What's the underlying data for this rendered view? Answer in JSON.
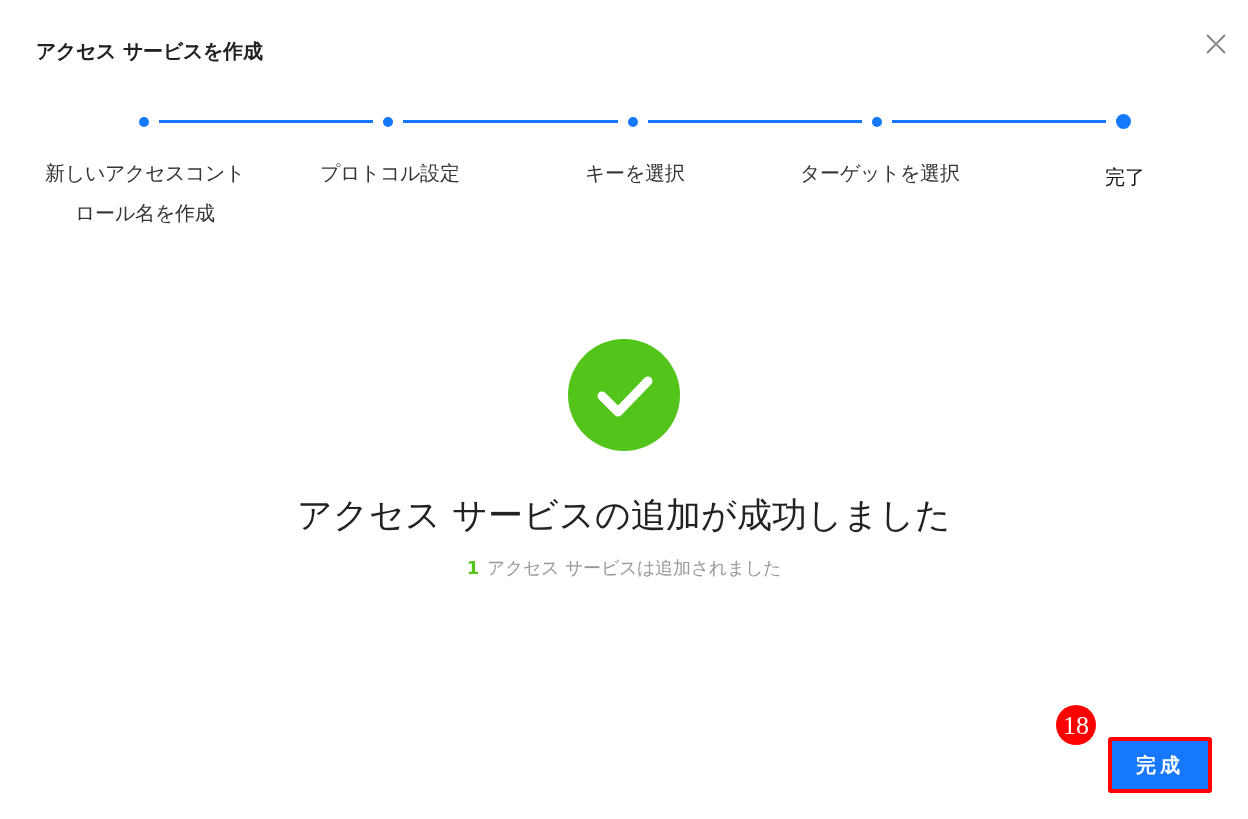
{
  "dialog": {
    "title": "アクセス サービスを作成"
  },
  "steps": [
    {
      "label": "新しいアクセスコントロール名を作成",
      "current": false
    },
    {
      "label": "プロトコル設定",
      "current": false
    },
    {
      "label": "キーを選択",
      "current": false
    },
    {
      "label": "ターゲットを選択",
      "current": false
    },
    {
      "label": "完了",
      "current": true
    }
  ],
  "result": {
    "heading": "アクセス サービスの追加が成功しました",
    "count": "1",
    "message": "アクセス サービスは追加されました"
  },
  "finish_button": {
    "label": "完成",
    "highlighted": true
  },
  "annotation": {
    "badge": "18"
  }
}
